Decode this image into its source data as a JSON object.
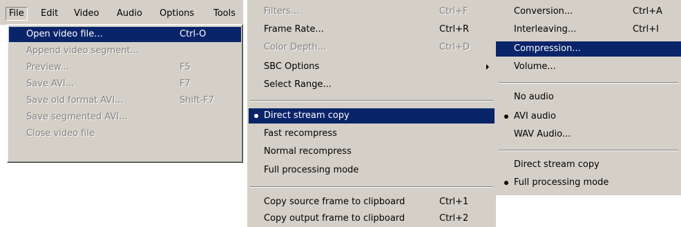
{
  "menubar": {
    "items": [
      "File",
      "Edit",
      "Video",
      "Audio",
      "Options",
      "Tools"
    ]
  },
  "file_menu": {
    "items": [
      {
        "label": "Open video file...",
        "shortcut": "Ctrl-O"
      },
      {
        "label": "Append video segment...",
        "shortcut": ""
      },
      {
        "label": "Preview...",
        "shortcut": "F5"
      },
      {
        "label": "Save AVI...",
        "shortcut": "F7"
      },
      {
        "label": "Save old format AVI...",
        "shortcut": "Shift-F7"
      },
      {
        "label": "Save segmented AVI...",
        "shortcut": ""
      },
      {
        "label": "Close video file",
        "shortcut": ""
      }
    ]
  },
  "video_menu": {
    "items": [
      {
        "label": "Filters...",
        "shortcut": "Ctrl+F"
      },
      {
        "label": "Frame Rate...",
        "shortcut": "Ctrl+R"
      },
      {
        "label": "Color Depth...",
        "shortcut": "Ctrl+D"
      },
      {
        "label": "SBC Options",
        "shortcut": ""
      },
      {
        "label": "Select Range...",
        "shortcut": ""
      },
      {
        "label": "Direct stream copy",
        "shortcut": ""
      },
      {
        "label": "Fast recompress",
        "shortcut": ""
      },
      {
        "label": "Normal recompress",
        "shortcut": ""
      },
      {
        "label": "Full processing mode",
        "shortcut": ""
      },
      {
        "label": "Copy source frame to clipboard",
        "shortcut": "Ctrl+1"
      },
      {
        "label": "Copy output frame to clipboard",
        "shortcut": "Ctrl+2"
      }
    ]
  },
  "audio_menu": {
    "items": [
      {
        "label": "Conversion...",
        "shortcut": "Ctrl+A"
      },
      {
        "label": "Interleaving...",
        "shortcut": "Ctrl+I"
      },
      {
        "label": "Compression...",
        "shortcut": ""
      },
      {
        "label": "Volume...",
        "shortcut": ""
      },
      {
        "label": "No audio",
        "shortcut": ""
      },
      {
        "label": "AVI audio",
        "shortcut": ""
      },
      {
        "label": "WAV Audio...",
        "shortcut": ""
      },
      {
        "label": "Direct stream copy",
        "shortcut": ""
      },
      {
        "label": "Full processing mode",
        "shortcut": ""
      }
    ]
  }
}
